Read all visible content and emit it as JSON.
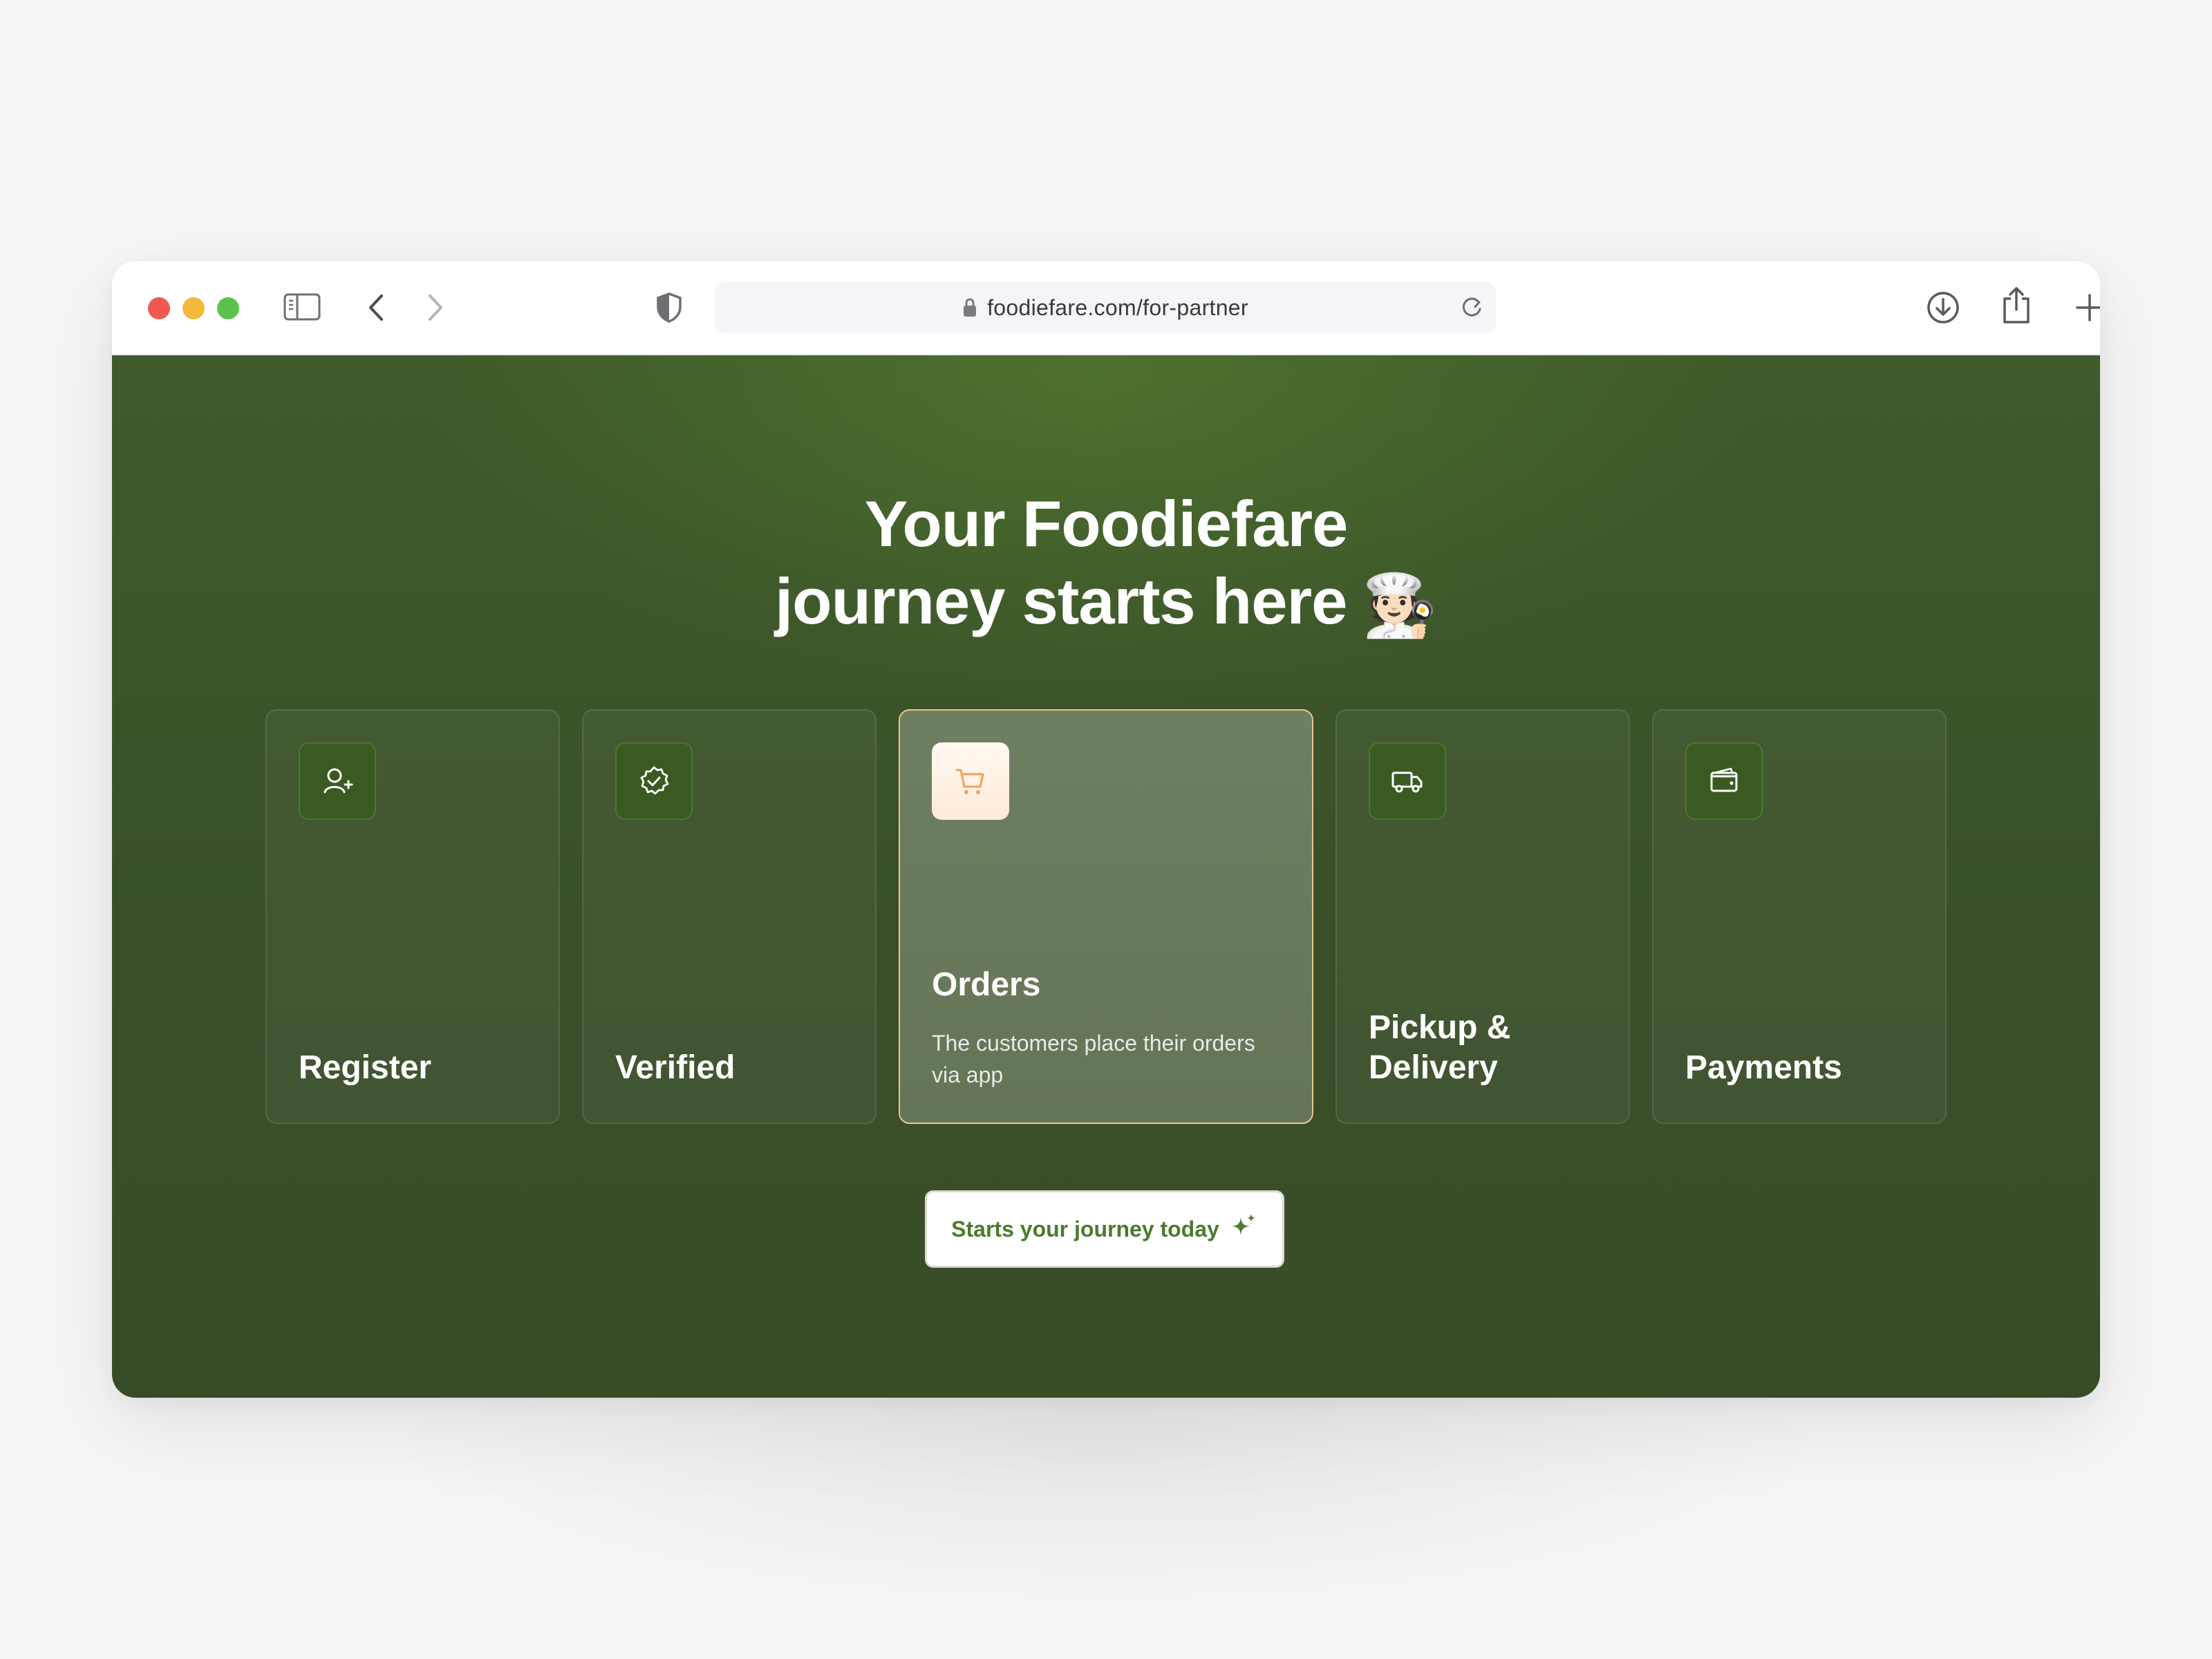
{
  "browser": {
    "url": "foodiefare.com/for-partner",
    "icons": [
      "close-dot",
      "minimize-dot",
      "zoom-dot",
      "sidebar-icon",
      "back-icon",
      "forward-icon",
      "shield-icon",
      "lock-icon",
      "reload-icon",
      "download-icon",
      "share-icon",
      "new-tab-icon",
      "tabs-overview-icon"
    ],
    "colors": {
      "close": "#ee5a52",
      "minimize": "#f2b93b",
      "zoom": "#5cc24c"
    }
  },
  "hero": {
    "title_line1": "Your Foodiefare",
    "title_line2": "journey starts here",
    "emoji": "🧑🏻‍🍳"
  },
  "steps": [
    {
      "label": "Register",
      "icon": "user-plus-icon",
      "active": false
    },
    {
      "label": "Verified",
      "icon": "verified-badge-icon",
      "active": false
    },
    {
      "label": "Orders",
      "icon": "cart-icon",
      "active": true,
      "description": "The customers place their orders via app"
    },
    {
      "label": "Pickup & Delivery",
      "icon": "truck-icon",
      "active": false
    },
    {
      "label": "Payments",
      "icon": "wallet-icon",
      "active": false
    }
  ],
  "cta": {
    "label": "Starts your journey today",
    "icon": "sparkle-icon"
  },
  "theme": {
    "background": "#3b4f29",
    "accent": "#4c7a2e",
    "highlight": "#e9c98a",
    "cart_icon": "#f0a35e"
  }
}
